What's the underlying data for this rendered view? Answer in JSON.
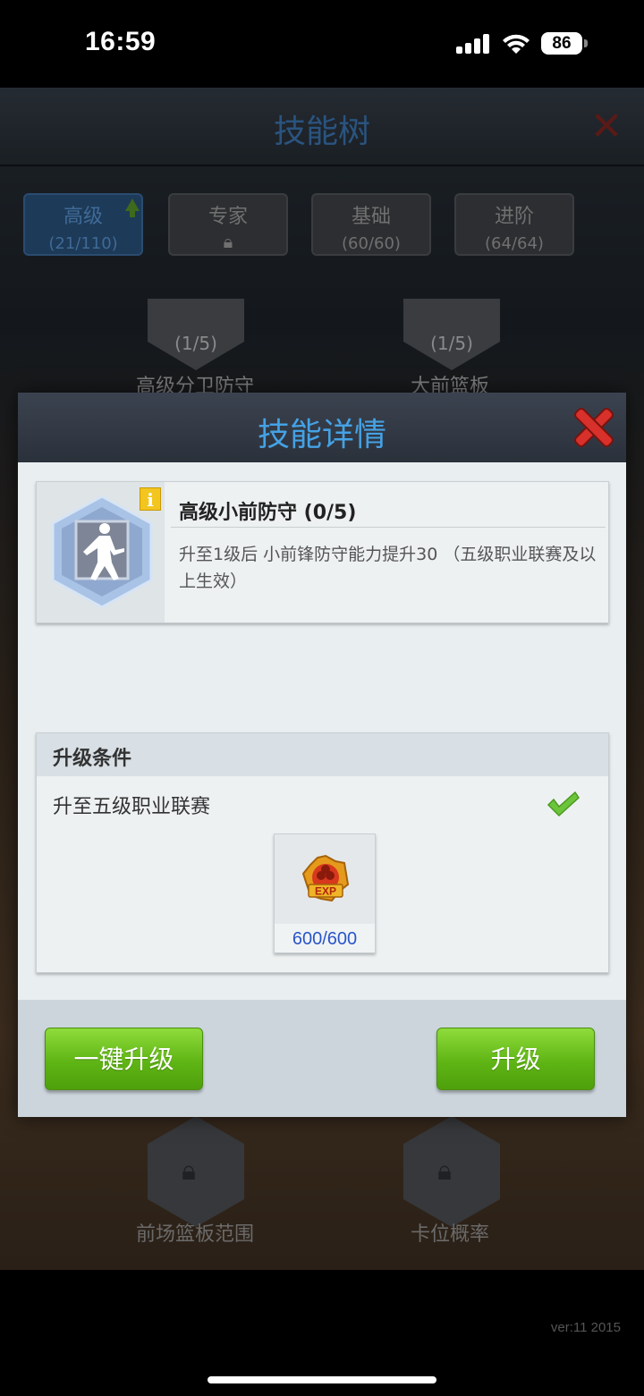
{
  "status_bar": {
    "time": "16:59",
    "battery": "86"
  },
  "background": {
    "title": "技能树",
    "tabs": [
      {
        "label": "高级",
        "count": "(21/110)"
      },
      {
        "label": "专家",
        "count": ""
      },
      {
        "label": "基础",
        "count": "(60/60)"
      },
      {
        "label": "进阶",
        "count": "(64/64)"
      }
    ],
    "top_nodes": [
      {
        "level": "(1/5)",
        "name": "高级分卫防守"
      },
      {
        "level": "(1/5)",
        "name": "大前篮板"
      }
    ],
    "bottom_nodes": [
      {
        "name": "前场篮板范围"
      },
      {
        "name": "卡位概率"
      }
    ],
    "version": "ver:11  2015"
  },
  "modal": {
    "title": "技能详情",
    "skill": {
      "name": "高级小前防守  (0/5)",
      "description": "升至1级后 小前锋防守能力提升30 （五级职业联赛及以上生效）",
      "info_badge": "i"
    },
    "conditions": {
      "title": "升级条件",
      "requirement": "升至五级职业联赛",
      "exp_label": "EXP",
      "exp_count": "600/600"
    },
    "buttons": {
      "one_click_upgrade": "一键升级",
      "upgrade": "升级"
    }
  },
  "colors": {
    "accent_blue": "#45a2e5",
    "button_green": "#5fb514",
    "close_red": "#d8302a",
    "check_green": "#6cc43a",
    "exp_count_blue": "#2a55c8"
  }
}
